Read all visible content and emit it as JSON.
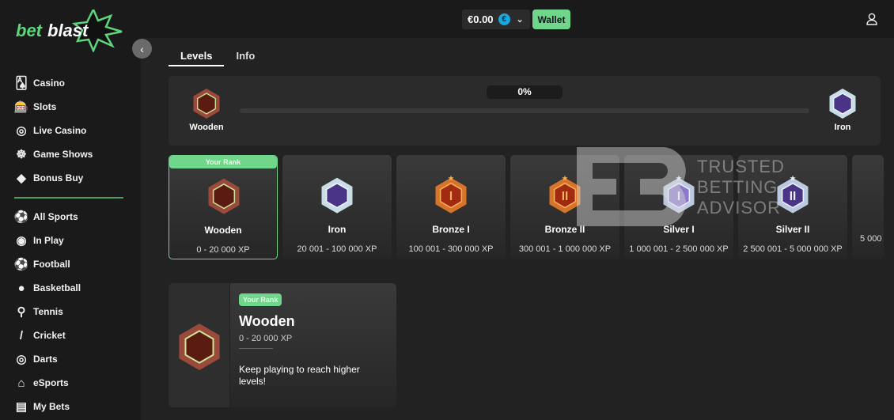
{
  "brand": {
    "logo_text_1": "bet",
    "logo_text_2": "blast",
    "accent": "#6fd68b"
  },
  "header": {
    "balance": "€0.00",
    "currency_symbol": "€",
    "wallet_label": "Wallet"
  },
  "sidebar": {
    "items": [
      {
        "label": "Casino",
        "icon": "cards-icon"
      },
      {
        "label": "Slots",
        "icon": "slot-machine-icon"
      },
      {
        "label": "Live Casino",
        "icon": "chip-icon"
      },
      {
        "label": "Game Shows",
        "icon": "wheel-icon"
      },
      {
        "label": "Bonus Buy",
        "icon": "diamond-icon"
      },
      {
        "label": "All Sports",
        "icon": "sports-icon"
      },
      {
        "label": "In Play",
        "icon": "broadcast-icon"
      },
      {
        "label": "Football",
        "icon": "football-icon"
      },
      {
        "label": "Basketball",
        "icon": "basketball-icon"
      },
      {
        "label": "Tennis",
        "icon": "tennis-icon"
      },
      {
        "label": "Cricket",
        "icon": "cricket-icon"
      },
      {
        "label": "Darts",
        "icon": "darts-icon"
      },
      {
        "label": "eSports",
        "icon": "gamepad-icon"
      },
      {
        "label": "My Bets",
        "icon": "tickets-icon"
      }
    ]
  },
  "tabs": [
    {
      "label": "Levels",
      "active": true
    },
    {
      "label": "Info",
      "active": false
    }
  ],
  "progress": {
    "current": "Wooden",
    "next": "Iron",
    "percent_label": "0%",
    "percent": 0
  },
  "your_rank_label": "Your Rank",
  "levels": [
    {
      "name": "Wooden",
      "xp": "0 - 20 000 XP",
      "current": true
    },
    {
      "name": "Iron",
      "xp": "20 001 - 100 000 XP"
    },
    {
      "name": "Bronze I",
      "xp": "100 001 - 300 000 XP"
    },
    {
      "name": "Bronze II",
      "xp": "300 001 - 1 000 000 XP"
    },
    {
      "name": "Silver I",
      "xp": "1 000 001 - 2 500 000 XP"
    },
    {
      "name": "Silver II",
      "xp": "2 500 001 - 5 000 000 XP"
    },
    {
      "name": "",
      "xp": "5 000"
    }
  ],
  "detail": {
    "badge": "Your Rank",
    "name": "Wooden",
    "xp": "0 - 20 000 XP",
    "message": "Keep playing to reach higher levels!"
  },
  "watermark": {
    "line1": "TRUSTED",
    "line2": "BETTING",
    "line3": "ADVISOR"
  }
}
